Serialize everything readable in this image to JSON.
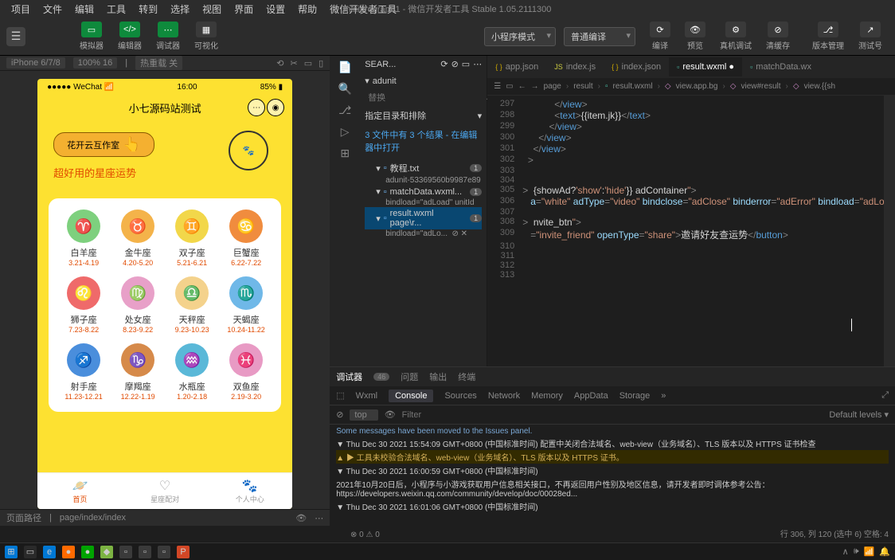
{
  "window": {
    "title": "miniprogram-1 - 微信开发者工具 Stable 1.05.2111300"
  },
  "menu": [
    "项目",
    "文件",
    "编辑",
    "工具",
    "转到",
    "选择",
    "视图",
    "界面",
    "设置",
    "帮助",
    "微信开发者工具"
  ],
  "toolbar": {
    "simulator": "模拟器",
    "editor": "编辑器",
    "debugger": "调试器",
    "visualizer": "可视化",
    "mode": "小程序模式",
    "compile": "普通编译",
    "compile_btn": "编译",
    "preview": "预览",
    "real": "真机调试",
    "cache": "清缓存",
    "vcs": "版本管理",
    "testid": "测试号"
  },
  "sim_header": {
    "device": "iPhone 6/7/8",
    "scale": "100% 16",
    "hot": "热重载 关"
  },
  "phone": {
    "carrier": "●●●●● WeChat",
    "time": "16:00",
    "battery": "85%",
    "title": "小七源码站测试",
    "banner_btn": "花开云互作室",
    "banner_sub": "超好用的星座运势",
    "tabs": [
      "首页",
      "星座配对",
      "个人中心"
    ]
  },
  "zodiac": [
    {
      "name": "白羊座",
      "date": "3.21-4.19",
      "color": "#7ed07e",
      "sym": "♈"
    },
    {
      "name": "金牛座",
      "date": "4.20-5.20",
      "color": "#f4b34a",
      "sym": "♉"
    },
    {
      "name": "双子座",
      "date": "5.21-6.21",
      "color": "#f2d74a",
      "sym": "♊"
    },
    {
      "name": "巨蟹座",
      "date": "6.22-7.22",
      "color": "#f08c3e",
      "sym": "♋"
    },
    {
      "name": "狮子座",
      "date": "7.23-8.22",
      "color": "#ef6a6a",
      "sym": "♌"
    },
    {
      "name": "处女座",
      "date": "8.23-9.22",
      "color": "#e8a0c8",
      "sym": "♍"
    },
    {
      "name": "天秤座",
      "date": "9.23-10.23",
      "color": "#f4d28c",
      "sym": "♎"
    },
    {
      "name": "天蝎座",
      "date": "10.24-11.22",
      "color": "#6fb8e8",
      "sym": "♏"
    },
    {
      "name": "射手座",
      "date": "11.23-12.21",
      "color": "#4a8edc",
      "sym": "♐"
    },
    {
      "name": "摩羯座",
      "date": "12.22-1.19",
      "color": "#d68a4a",
      "sym": "♑"
    },
    {
      "name": "水瓶座",
      "date": "1.20-2.18",
      "color": "#5ab8d8",
      "sym": "♒"
    },
    {
      "name": "双鱼座",
      "date": "2.19-3.20",
      "color": "#e89ac4",
      "sym": "♓"
    }
  ],
  "left_footer": {
    "label": "页面路径",
    "path": "page/index/index"
  },
  "search": {
    "label": "SEAR...",
    "query": "adunit",
    "replace": "替换",
    "exclude": "指定目录和排除",
    "summary": "3 文件中有 3 个结果 - 在编辑器中打开",
    "files": [
      {
        "name": "教程.txt",
        "count": "1",
        "sub": "adunit-53369560b9987e89"
      },
      {
        "name": "matchData.wxml...",
        "count": "1",
        "sub": "bindload=\"adLoad\" unitId"
      },
      {
        "name": "result.wxml page\\r...",
        "count": "1",
        "sub": "bindload=\"adLo..."
      }
    ]
  },
  "editor": {
    "tabs": [
      {
        "label": "app.json",
        "icon": "json"
      },
      {
        "label": "index.js",
        "icon": "js"
      },
      {
        "label": "index.json",
        "icon": "json"
      },
      {
        "label": "result.wxml",
        "icon": "wxml",
        "active": true,
        "dirty": true
      },
      {
        "label": "matchData.wx",
        "icon": "wxml"
      }
    ],
    "breadcrumb": [
      "page",
      "result",
      "result.wxml",
      "view.app.bg",
      "view#result",
      "view.{{sh"
    ],
    "lines": [
      {
        "n": 297,
        "html": "            <span class='pun'>&lt;/</span><span class='tag'>view</span><span class='pun'>&gt;</span>"
      },
      {
        "n": 298,
        "html": "            <span class='pun'>&lt;</span><span class='tag'>text</span><span class='pun'>&gt;</span><span class='txt'>{{item.jk}}</span><span class='pun'>&lt;/</span><span class='tag'>text</span><span class='pun'>&gt;</span>"
      },
      {
        "n": 299,
        "html": "          <span class='pun'>&lt;/</span><span class='tag'>view</span><span class='pun'>&gt;</span>"
      },
      {
        "n": 300,
        "html": "      <span class='pun'>&lt;/</span><span class='tag'>view</span><span class='pun'>&gt;</span>"
      },
      {
        "n": 301,
        "html": "    <span class='pun'>&lt;/</span><span class='tag'>view</span><span class='pun'>&gt;</span>"
      },
      {
        "n": 302,
        "html": "  <span class='pun'>&gt;</span>"
      },
      {
        "n": 303,
        "html": ""
      },
      {
        "n": 304,
        "html": ""
      },
      {
        "n": 305,
        "html": "<span class='pun'>&gt;</span>  <span class='txt'>{showAd?</span><span class='str'>'show'</span><span class='txt'>:</span><span class='str'>'hide'</span><span class='txt'>}} adContainer</span><span class='str'>\"</span><span class='pun'>&gt;</span>"
      },
      {
        "n": 306,
        "html": "   <span class='attr'>a</span><span class='pun'>=</span><span class='str'>\"white\"</span> <span class='attr'>adType</span><span class='pun'>=</span><span class='str'>\"video\"</span> <span class='attr'>bindclose</span><span class='pun'>=</span><span class='str'>\"adClose\"</span> <span class='attr'>binderror</span><span class='pun'>=</span><span class='str'>\"adError\"</span> <span class='attr'>bindload</span><span class='pun'>=</span><span class='str'>\"adLoad</span>"
      },
      {
        "n": 307,
        "html": ""
      },
      {
        "n": 308,
        "html": "<span class='pun'>&gt;</span>  <span class='txt'>nvite_btn</span><span class='str'>\"</span><span class='pun'>&gt;</span>"
      },
      {
        "n": 309,
        "html": "   <span class='pun'>=</span><span class='str'>\"invite_friend\"</span> <span class='attr'>openType</span><span class='pun'>=</span><span class='str'>\"share\"</span><span class='pun'>&gt;</span><span class='txt'>邀请好友查运势</span><span class='pun'>&lt;/</span><span class='tag'>button</span><span class='pun'>&gt;</span>"
      },
      {
        "n": 310,
        "html": ""
      },
      {
        "n": 311,
        "html": ""
      },
      {
        "n": 312,
        "html": ""
      },
      {
        "n": 313,
        "html": ""
      }
    ]
  },
  "console": {
    "tabs": [
      "调试器",
      "问题",
      "输出",
      "终端"
    ],
    "count": "46",
    "subtabs": [
      "Wxml",
      "Console",
      "Sources",
      "Network",
      "Memory",
      "AppData",
      "Storage"
    ],
    "filter_top": "top",
    "filter_ph": "Filter",
    "levels": "Default levels",
    "logs": [
      {
        "cls": "log-info",
        "text": "Some messages have been moved to the Issues panel."
      },
      {
        "cls": "log-plain",
        "text": "▼ Thu Dec 30 2021 15:54:09 GMT+0800 (中国标准时间) 配置中关闭合法域名、web-view（业务域名）、TLS 版本以及 HTTPS 证书检查"
      },
      {
        "cls": "log-warn",
        "text": "▲ ▶ 工具未校验合法域名、web-view（业务域名）、TLS 版本以及 HTTPS 证书。"
      },
      {
        "cls": "log-plain",
        "text": "▼ Thu Dec 30 2021 16:00:59 GMT+0800 (中国标准时间)"
      },
      {
        "cls": "log-plain",
        "text": "  2021年10月20日后，小程序与小游戏获取用户信息相关接口，不再返回用户性别及地区信息，请开发者即时调体参考公告：https://developers.weixin.qq.com/community/develop/doc/00028ed..."
      },
      {
        "cls": "log-plain",
        "text": "▼ Thu Dec 30 2021 16:01:06 GMT+0800 (中国标准时间)"
      }
    ]
  },
  "status": {
    "pos": "行 306, 列 120 (选中 6)   空格: 4"
  },
  "errors": "⊗ 0 ⚠ 0"
}
